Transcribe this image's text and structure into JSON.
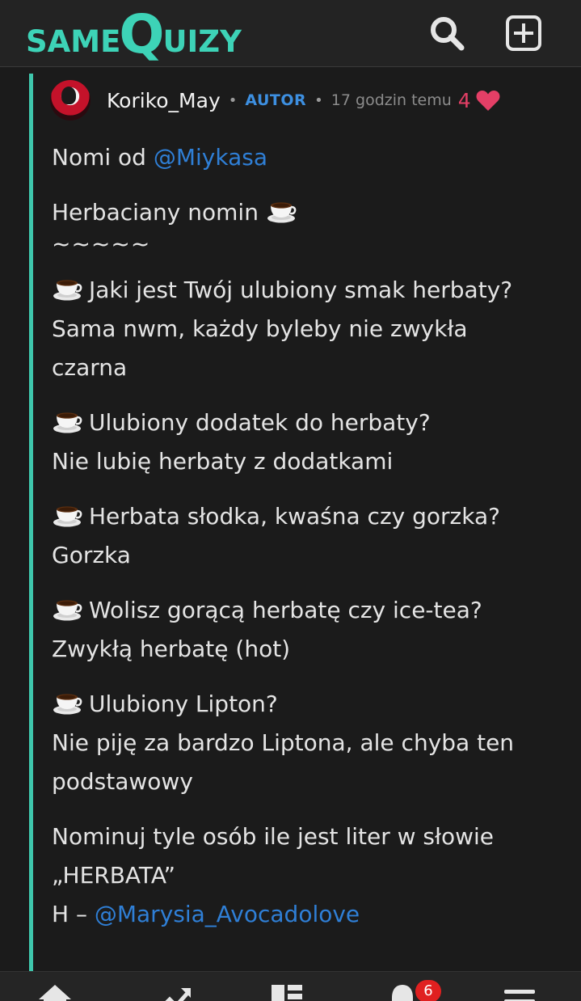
{
  "header": {
    "logo": {
      "same": "SAME",
      "q": "Q",
      "uizy": "UIZY"
    },
    "icons": {
      "search": "search-icon",
      "add": "plus-square-icon"
    }
  },
  "post": {
    "username": "Koriko_May",
    "separator": "•",
    "role_badge": "AUTOR",
    "time": "17 godzin temu",
    "likes": "4",
    "intro_text": "Nomi od ",
    "intro_mention": "@Miykasa",
    "tag_title": "Herbaciany nomin",
    "tilde_line": "~~~~~",
    "qa": [
      {
        "q": "Jaki jest Twój ulubiony smak herbaty?",
        "a": "Sama nwm, każdy byleby nie zwykła czarna"
      },
      {
        "q": "Ulubiony dodatek do herbaty?",
        "a": "Nie lubię herbaty z dodatkami"
      },
      {
        "q": "Herbata słodka, kwaśna czy gorzka?",
        "a": "Gorzka"
      },
      {
        "q": "Wolisz gorącą herbatę czy ice-tea?",
        "a": "Zwykłą herbatę (hot)"
      },
      {
        "q": "Ulubiony Lipton?",
        "a": "Nie piję za bardzo Liptona, ale chyba ten podstawowy"
      }
    ],
    "nominate_text": "Nominuj tyle osób ile jest liter w słowie „HERBATA”",
    "nominee_prefix": "H – ",
    "nominee_mention": "@Marysia_Avocadolove"
  },
  "bottom_nav": {
    "items": [
      "home-icon",
      "trending-icon",
      "feed-icon",
      "bell-icon",
      "menu-icon"
    ],
    "notification_count": "6"
  },
  "colors": {
    "accent": "#3dd3b7",
    "mention": "#2f7fd6",
    "author_badge": "#3d8fe0",
    "like": "#e43f66",
    "background": "#1b1b1b"
  }
}
